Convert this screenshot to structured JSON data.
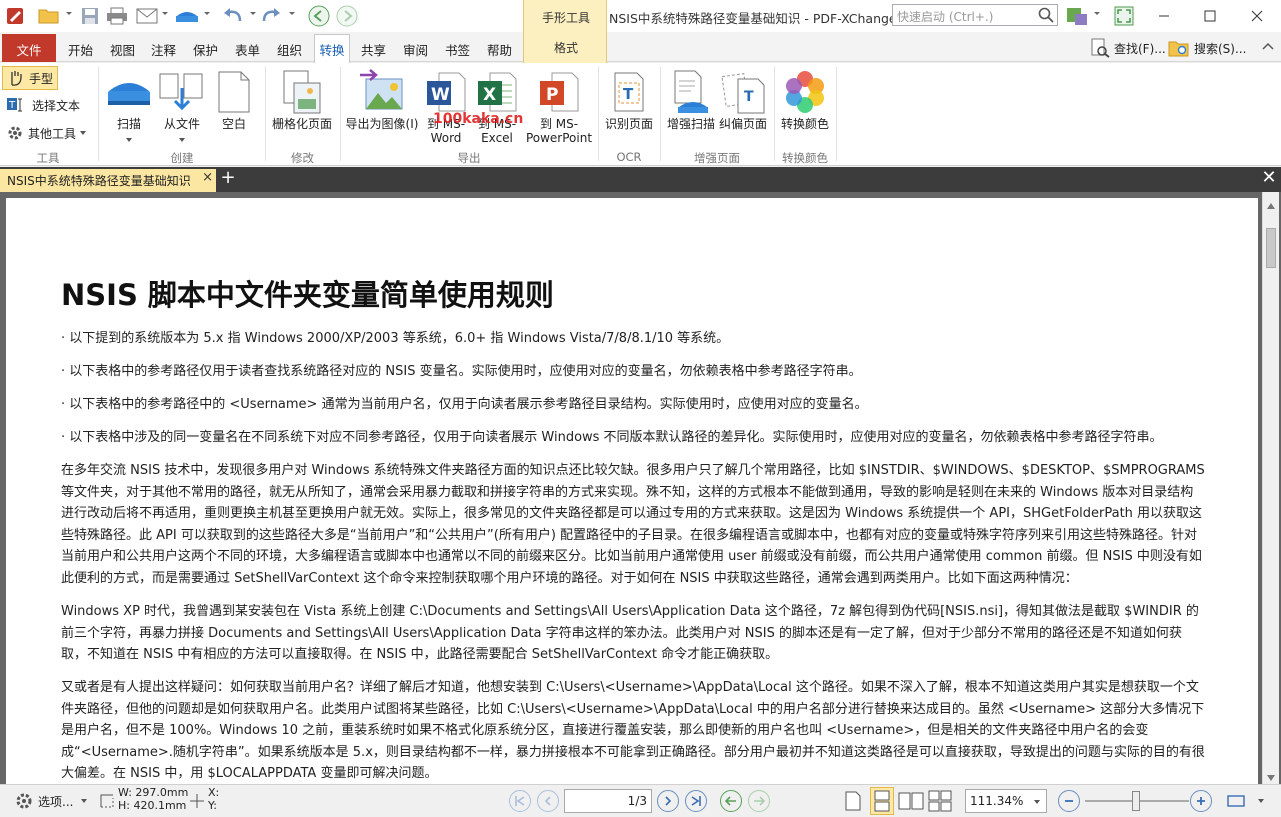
{
  "window": {
    "title": "NSIS中系统特殊路径变量基础知识 - PDF-XChange...",
    "quick_launch_placeholder": "快速启动 (Ctrl+.)",
    "context_tab_group": "手形工具",
    "context_tab_format": "格式"
  },
  "menu": {
    "file": "文件",
    "items": [
      "开始",
      "视图",
      "注释",
      "保护",
      "表单",
      "组织",
      "转换",
      "共享",
      "审阅",
      "书签",
      "帮助"
    ],
    "active": "转换",
    "find": "查找(F)...",
    "search": "搜索(S)..."
  },
  "ribbon": {
    "tools_group": {
      "hand": "手型",
      "select_text": "选择文本",
      "other_tools": "其他工具",
      "label": "工具"
    },
    "create_group": {
      "scan": "扫描",
      "from_file": "从文件",
      "blank": "空白",
      "label": "创建"
    },
    "modify_group": {
      "rasterize": "栅格化页面",
      "label": "修改"
    },
    "export_group": {
      "export_image": "导出为图像(I)",
      "to_word_1": "到 MS-",
      "to_word_2": "Word",
      "to_excel_1": "到 MS-",
      "to_excel_2": "Excel",
      "to_ppt_1": "到 MS-",
      "to_ppt_2": "PowerPoint",
      "label": "导出"
    },
    "ocr_group": {
      "recognize": "识别页面",
      "label": "OCR"
    },
    "enhance_group": {
      "enhance_scan": "增强扫描",
      "deskew": "纠偏页面",
      "label": "增强页面"
    },
    "color_group": {
      "convert_color": "转换颜色",
      "label": "转换颜色"
    },
    "watermark": "100kaka.cn"
  },
  "tabs": {
    "doc_tab": "NSIS中系统特殊路径变量基础知识",
    "close": "×",
    "new": "+",
    "close_all": "✕"
  },
  "document": {
    "title": "NSIS 脚本中文件夹变量简单使用规则",
    "bullets": [
      "· 以下提到的系统版本为 5.x 指 Windows 2000/XP/2003 等系统，6.0+ 指 Windows Vista/7/8/8.1/10 等系统。",
      "· 以下表格中的参考路径仅用于读者查找系统路径对应的 NSIS 变量名。实际使用时，应使用对应的变量名，勿依赖表格中参考路径字符串。",
      "· 以下表格中的参考路径中的 <Username> 通常为当前用户名，仅用于向读者展示参考路径目录结构。实际使用时，应使用对应的变量名。",
      "· 以下表格中涉及的同一变量名在不同系统下对应不同参考路径，仅用于向读者展示 Windows 不同版本默认路径的差异化。实际使用时，应使用对应的变量名，勿依赖表格中参考路径字符串。"
    ],
    "paragraph1": "在多年交流 NSIS 技术中，发现很多用户对 Windows 系统特殊文件夹路径方面的知识点还比较欠缺。很多用户只了解几个常用路径，比如 $INSTDIR、$WINDOWS、$DESKTOP、$SMPROGRAMS 等文件夹，对于其他不常用的路径，就无从所知了，通常会采用暴力截取和拼接字符串的方式来实现。殊不知，这样的方式根本不能做到通用，导致的影响是轻则在未来的 Windows 版本对目录结构进行改动后将不再适用，重则更换主机甚至更换用户就无效。实际上，很多常见的文件夹路径都是可以通过专用的方式来获取。这是因为 Windows 系统提供一个 API，SHGetFolderPath 用以获取这些特殊路径。此 API 可以获取到的这些路径大多是“当前用户”和“公共用户”(所有用户) 配置路径中的子目录。在很多编程语言或脚本中，也都有对应的变量或特殊字符序列来引用这些特殊路径。针对当前用户和公共用户这两个不同的环境，大多编程语言或脚本中也通常以不同的前缀来区分。比如当前用户通常使用 user 前缀或没有前缀，而公共用户通常使用 common 前缀。但 NSIS 中则没有如此便利的方式，而是需要通过 SetShellVarContext 这个命令来控制获取哪个用户环境的路径。对于如何在 NSIS 中获取这些路径，通常会遇到两类用户。比如下面这两种情况：",
    "paragraph2": "Windows XP 时代，我曾遇到某安装包在 Vista 系统上创建 C:\\Documents and Settings\\All Users\\Application Data 这个路径，7z 解包得到伪代码[NSIS.nsi]，得知其做法是截取 $WINDIR 的前三个字符，再暴力拼接 Documents and Settings\\All Users\\Application Data 字符串这样的笨办法。此类用户对 NSIS 的脚本还是有一定了解，但对于少部分不常用的路径还是不知道如何获取，不知道在 NSIS 中有相应的方法可以直接取得。在 NSIS 中，此路径需要配合 SetShellVarContext 命令才能正确获取。",
    "paragraph3": "又或者是有人提出这样疑问：如何获取当前用户名？详细了解后才知道，他想安装到 C:\\Users\\<Username>\\AppData\\Local 这个路径。如果不深入了解，根本不知道这类用户其实是想获取一个文件夹路径，但他的问题却是如何获取用户名。此类用户试图将某些路径，比如 C:\\Users\\<Username>\\AppData\\Local 中的用户名部分进行替换来达成目的。虽然 <Username> 这部分大多情况下是用户名，但不是 100%。Windows 10 之前，重装系统时如果不格式化原系统分区，直接进行覆盖安装，那么即使新的用户名也叫 <Username>，但是相关的文件夹路径中用户名的会变成“<Username>.随机字符串”。如果系统版本是 5.x，则目录结构都不一样，暴力拼接根本不可能拿到正确路径。部分用户最初并不知道这类路径是可以直接获取，导致提出的问题与实际的目的有很大偏差。在 NSIS 中，用 $LOCALAPPDATA 变量即可解决问题。"
  },
  "status": {
    "options": "选项...",
    "width": "W: 297.0mm",
    "height": "H: 420.1mm",
    "x": "X:",
    "y": "Y:",
    "page_current": "1",
    "page_total": "/3",
    "zoom": "111.34%"
  },
  "colors": {
    "accent": "#c0392b",
    "active_tab": "#fbe7a2",
    "link_blue": "#1a5fb4"
  }
}
